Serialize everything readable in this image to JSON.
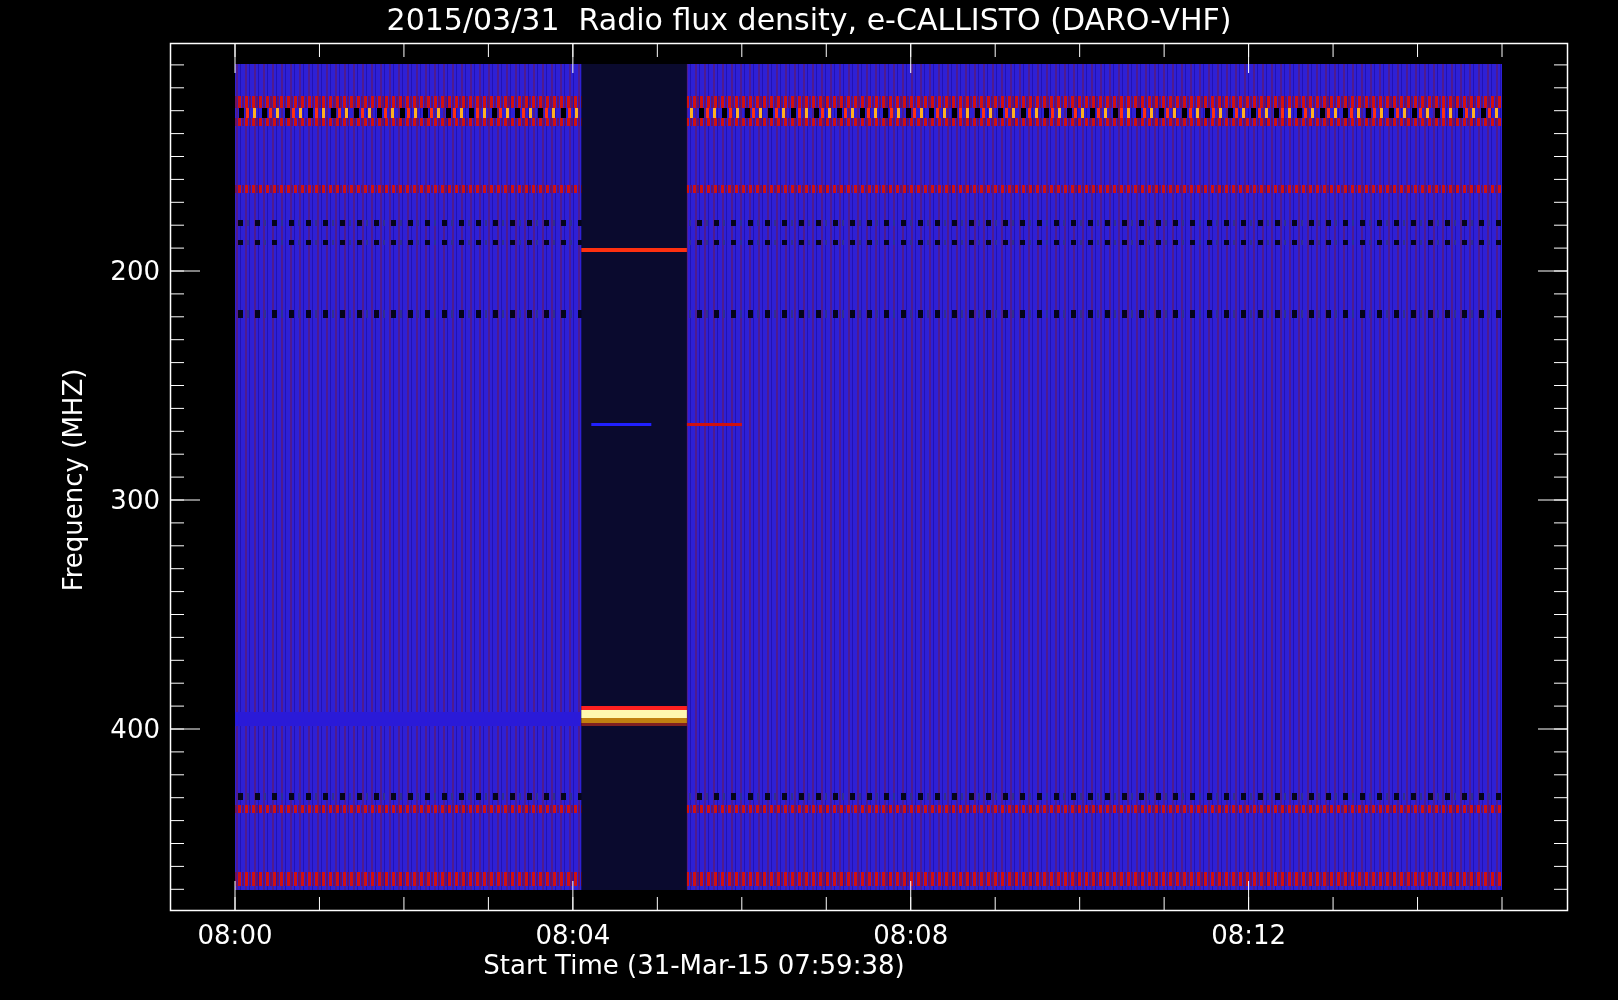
{
  "plot": {
    "title": "2015/03/31  Radio flux density, e-CALLISTO (DARO-VHF)",
    "ylabel": "Frequency (MHZ)",
    "xlabel": "Start Time (31-Mar-15 07:59:38)",
    "yticks": [
      "200",
      "300",
      "400"
    ],
    "xticks": [
      "08:00",
      "08:04",
      "08:08",
      "08:12"
    ]
  }
}
